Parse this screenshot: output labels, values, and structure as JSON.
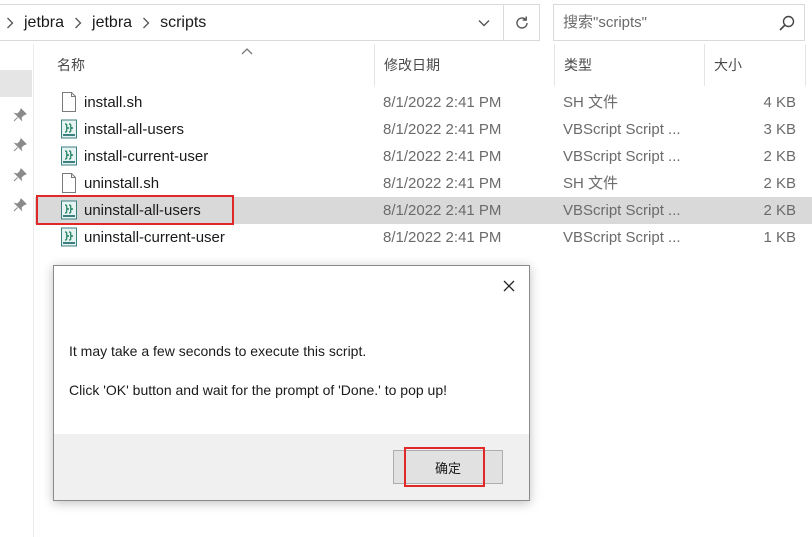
{
  "address_bar": {
    "breadcrumbs": [
      "jetbra",
      "jetbra",
      "scripts"
    ]
  },
  "search": {
    "placeholder": "搜索\"scripts\""
  },
  "columns": {
    "name": "名称",
    "date": "修改日期",
    "type": "类型",
    "size": "大小"
  },
  "files": [
    {
      "name": "install.sh",
      "date": "8/1/2022 2:41 PM",
      "type": "SH 文件",
      "size": "4 KB",
      "icon": "sh-file-icon"
    },
    {
      "name": "install-all-users",
      "date": "8/1/2022 2:41 PM",
      "type": "VBScript Script ...",
      "size": "3 KB",
      "icon": "vbscript-file-icon"
    },
    {
      "name": "install-current-user",
      "date": "8/1/2022 2:41 PM",
      "type": "VBScript Script ...",
      "size": "2 KB",
      "icon": "vbscript-file-icon"
    },
    {
      "name": "uninstall.sh",
      "date": "8/1/2022 2:41 PM",
      "type": "SH 文件",
      "size": "2 KB",
      "icon": "sh-file-icon"
    },
    {
      "name": "uninstall-all-users",
      "date": "8/1/2022 2:41 PM",
      "type": "VBScript Script ...",
      "size": "2 KB",
      "icon": "vbscript-file-icon",
      "selected": true
    },
    {
      "name": "uninstall-current-user",
      "date": "8/1/2022 2:41 PM",
      "type": "VBScript Script ...",
      "size": "1 KB",
      "icon": "vbscript-file-icon"
    }
  ],
  "dialog": {
    "message_line1": "It may take a few seconds to execute this script.",
    "message_line2": "Click 'OK' button and wait for the prompt of 'Done.' to pop up!",
    "ok_label": "确定"
  },
  "colors": {
    "highlight_box": "#e02828",
    "selected_row": "#d9d9d9"
  }
}
